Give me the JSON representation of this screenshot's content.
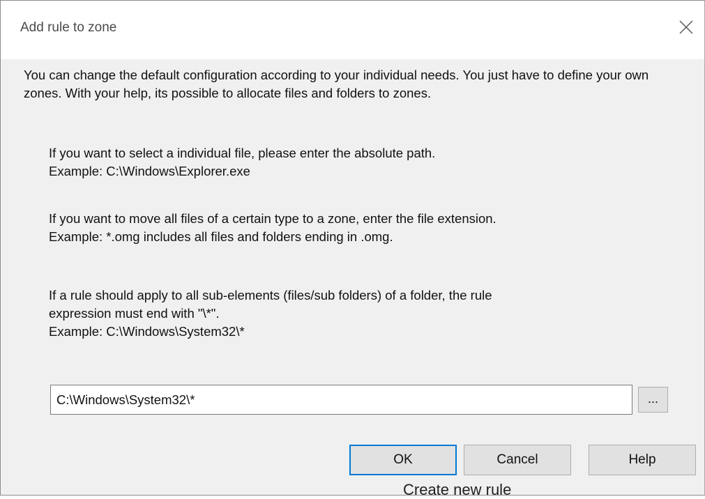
{
  "window": {
    "title": "Add rule to zone",
    "close_glyph": "close-icon"
  },
  "intro": "You can change the default configuration according to your individual needs. You just have to define your own zones. With your help, its possible to allocate files and folders to zones.",
  "hints": {
    "file": {
      "line1": "If you want to select a individual file, please enter the absolute path.",
      "line2": "Example: C:\\Windows\\Explorer.exe"
    },
    "extension": {
      "line1": "If you want to move all files of a certain type to a zone, enter the file extension.",
      "line2": "Example: *.omg includes all files and folders ending in .omg."
    },
    "folder": {
      "line1": "If a rule should apply to all sub-elements (files/sub folders) of a folder, the rule",
      "line2": "expression must end with \"\\*\".",
      "line3": "Example: C:\\Windows\\System32\\*"
    }
  },
  "path_input": {
    "value": "C:\\Windows\\System32\\*"
  },
  "browse_button": {
    "label": "..."
  },
  "buttons": {
    "ok": "OK",
    "cancel": "Cancel",
    "help": "Help"
  },
  "background_text": "Create new rule",
  "colors": {
    "dialog_bg": "#f0f0f0",
    "titlebar_bg": "#ffffff",
    "default_button_border": "#0078d7",
    "button_bg": "#e1e1e1"
  }
}
